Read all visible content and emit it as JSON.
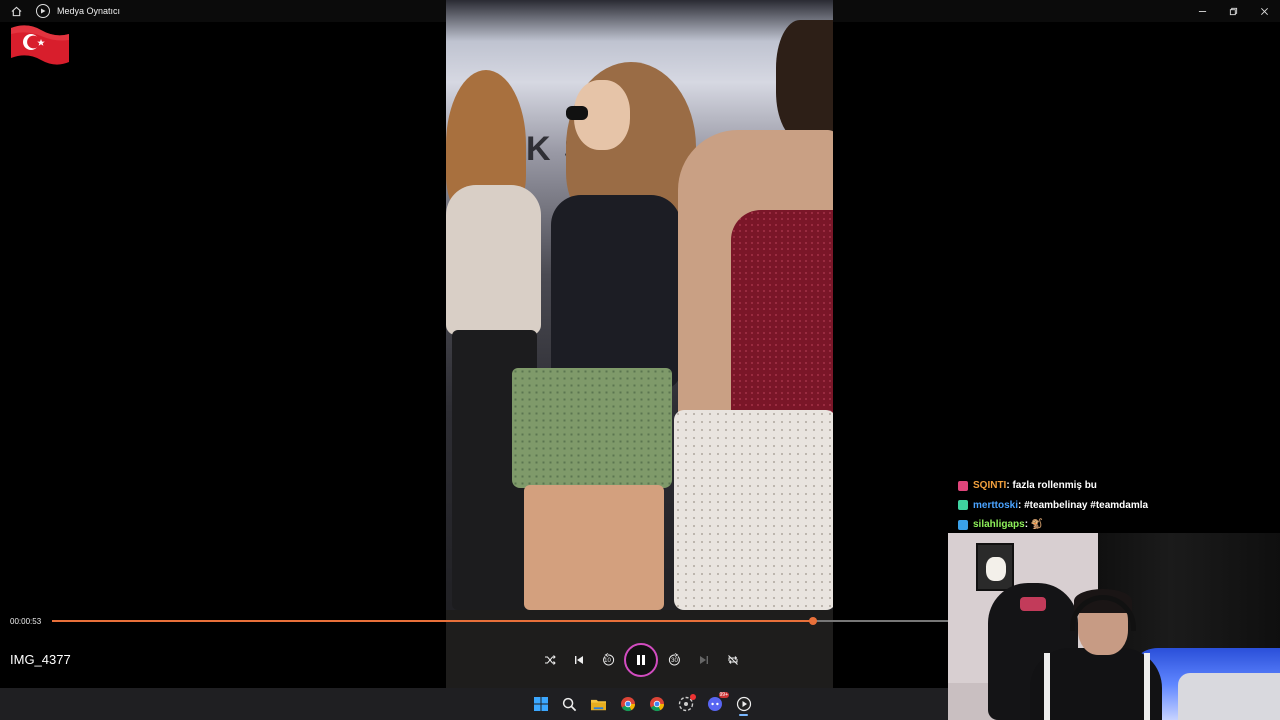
{
  "window": {
    "title": "Medya Oynatıcı"
  },
  "player": {
    "current_time": "00:00:53",
    "progress_fraction": 0.849,
    "file_name": "IMG_4377",
    "skip_back_label": "10",
    "skip_forward_label": "30",
    "state": "playing"
  },
  "colors": {
    "accent": "#e8703a",
    "play_ring": "#d24cc0"
  },
  "taskbar": {
    "apps": [
      "windows-start-icon",
      "search-icon",
      "file-explorer-icon",
      "chrome-icon",
      "chrome-icon",
      "app-icon",
      "discord-icon",
      "media-player-icon"
    ],
    "discord_badge": "99+"
  },
  "chat": {
    "messages": [
      {
        "user": "SQINTI",
        "text": " : fazla rollenmiş bu",
        "user_color": "#f2a03d",
        "badge_color": "#e0457b"
      },
      {
        "user": "merttoski",
        "text": " : #teambelinay #teamdamla",
        "user_color": "#4aa3ff",
        "badge_color": "#3fd3a0"
      },
      {
        "user": "silahligaps",
        "text": " : 🐒",
        "user_color": "#8ef05a",
        "badge_color": "#3aa0e8"
      }
    ]
  }
}
